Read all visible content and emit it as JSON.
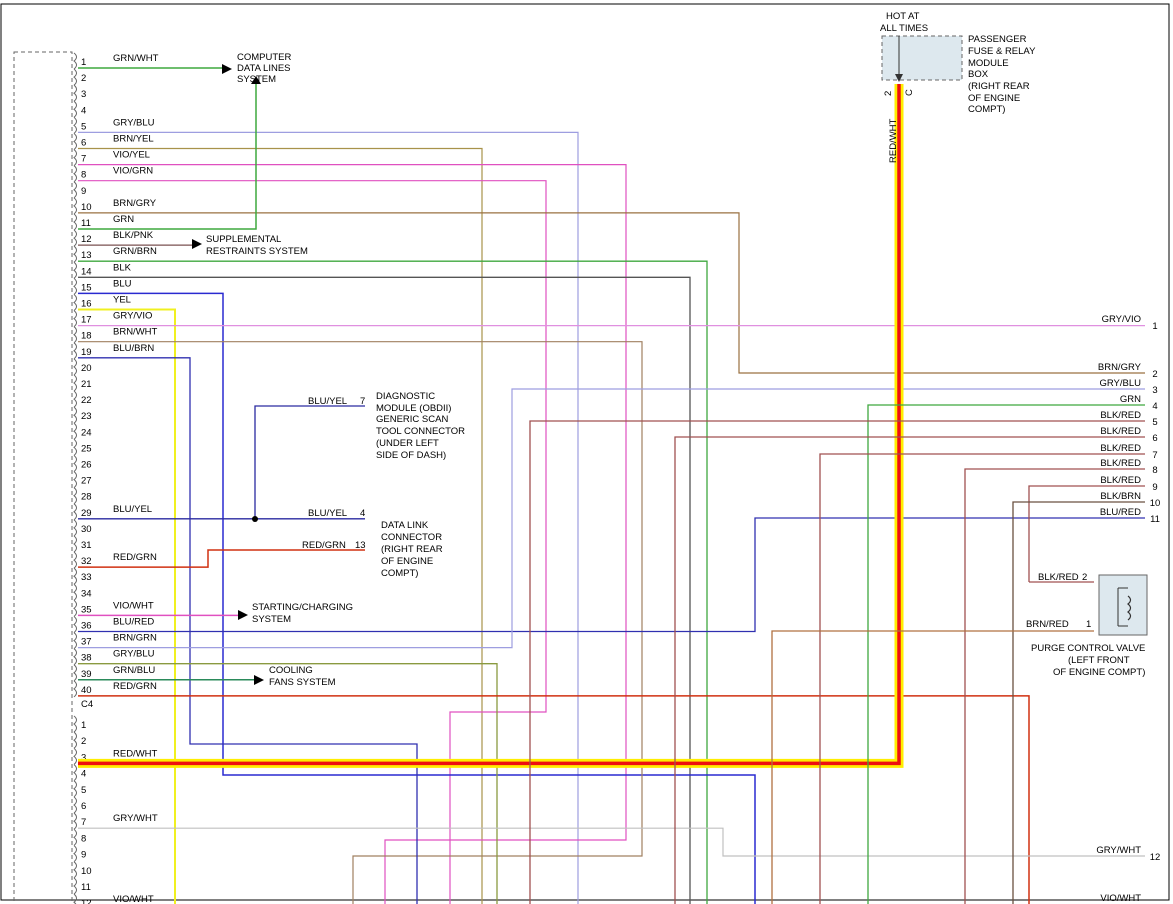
{
  "connector_c3_pins": [
    {
      "pin": "1",
      "label": "GRN/WHT"
    },
    {
      "pin": "2",
      "label": ""
    },
    {
      "pin": "3",
      "label": ""
    },
    {
      "pin": "4",
      "label": ""
    },
    {
      "pin": "5",
      "label": "GRY/BLU"
    },
    {
      "pin": "6",
      "label": "BRN/YEL"
    },
    {
      "pin": "7",
      "label": "VIO/YEL"
    },
    {
      "pin": "8",
      "label": "VIO/GRN"
    },
    {
      "pin": "9",
      "label": ""
    },
    {
      "pin": "10",
      "label": "BRN/GRY"
    },
    {
      "pin": "11",
      "label": "GRN"
    },
    {
      "pin": "12",
      "label": "BLK/PNK"
    },
    {
      "pin": "13",
      "label": "GRN/BRN"
    },
    {
      "pin": "14",
      "label": "BLK"
    },
    {
      "pin": "15",
      "label": "BLU"
    },
    {
      "pin": "16",
      "label": "YEL"
    },
    {
      "pin": "17",
      "label": "GRY/VIO"
    },
    {
      "pin": "18",
      "label": "BRN/WHT"
    },
    {
      "pin": "19",
      "label": "BLU/BRN"
    },
    {
      "pin": "20",
      "label": ""
    },
    {
      "pin": "21",
      "label": ""
    },
    {
      "pin": "22",
      "label": ""
    },
    {
      "pin": "23",
      "label": ""
    },
    {
      "pin": "24",
      "label": ""
    },
    {
      "pin": "25",
      "label": ""
    },
    {
      "pin": "26",
      "label": ""
    },
    {
      "pin": "27",
      "label": ""
    },
    {
      "pin": "28",
      "label": ""
    },
    {
      "pin": "29",
      "label": "BLU/YEL"
    },
    {
      "pin": "30",
      "label": ""
    },
    {
      "pin": "31",
      "label": ""
    },
    {
      "pin": "32",
      "label": "RED/GRN"
    },
    {
      "pin": "33",
      "label": ""
    },
    {
      "pin": "34",
      "label": ""
    },
    {
      "pin": "35",
      "label": "VIO/WHT"
    },
    {
      "pin": "36",
      "label": "BLU/RED"
    },
    {
      "pin": "37",
      "label": "BRN/GRN"
    },
    {
      "pin": "38",
      "label": "GRY/BLU"
    },
    {
      "pin": "39",
      "label": "GRN/BLU"
    },
    {
      "pin": "40",
      "label": "RED/GRN"
    }
  ],
  "connector_c4_label": "C4",
  "connector_c4_pins": [
    {
      "pin": "1",
      "label": ""
    },
    {
      "pin": "2",
      "label": ""
    },
    {
      "pin": "3",
      "label": "RED/WHT"
    },
    {
      "pin": "4",
      "label": ""
    },
    {
      "pin": "5",
      "label": ""
    },
    {
      "pin": "6",
      "label": ""
    },
    {
      "pin": "7",
      "label": "GRY/WHT"
    },
    {
      "pin": "8",
      "label": ""
    },
    {
      "pin": "9",
      "label": ""
    },
    {
      "pin": "10",
      "label": ""
    },
    {
      "pin": "11",
      "label": ""
    },
    {
      "pin": "12",
      "label": "VIO/WHT"
    }
  ],
  "destinations": {
    "computer_data_lines": [
      "COMPUTER",
      "DATA LINES",
      "SYSTEM"
    ],
    "supplemental_restraints": [
      "SUPPLEMENTAL",
      "RESTRAINTS SYSTEM"
    ],
    "starting_charging": [
      "STARTING/CHARGING",
      "SYSTEM"
    ],
    "cooling_fans": [
      "COOLING",
      "FANS SYSTEM"
    ],
    "diagnostic_module": [
      "DIAGNOSTIC",
      "MODULE (OBDII)",
      "GENERIC SCAN",
      "TOOL CONNECTOR",
      "(UNDER LEFT",
      "SIDE OF DASH)"
    ],
    "data_link_connector": [
      "DATA LINK",
      "CONNECTOR",
      "(RIGHT REAR",
      "OF ENGINE",
      "COMPT)"
    ],
    "fuse_box": [
      "PASSENGER",
      "FUSE & RELAY",
      "MODULE",
      "BOX",
      "(RIGHT REAR",
      "OF ENGINE",
      "COMPT)"
    ],
    "hot_at_all_times": [
      "HOT AT",
      "ALL TIMES"
    ],
    "purge_valve": [
      "PURGE CONTROL VALVE",
      "(LEFT FRONT",
      "OF ENGINE COMPT)"
    ]
  },
  "diag_wires": [
    {
      "label": "BLU/YEL",
      "pin": "7"
    },
    {
      "label": "BLU/YEL",
      "pin": "4"
    },
    {
      "label": "RED/GRN",
      "pin": "13"
    }
  ],
  "fuse_pins": {
    "left": "2",
    "right": "C",
    "wire_label": "RED/WHT"
  },
  "right_wires": [
    {
      "label": "GRY/VIO",
      "pin": "1"
    },
    {
      "label": "BRN/GRY",
      "pin": "2"
    },
    {
      "label": "GRY/BLU",
      "pin": "3"
    },
    {
      "label": "GRN",
      "pin": "4"
    },
    {
      "label": "BLK/RED",
      "pin": "5"
    },
    {
      "label": "BLK/RED",
      "pin": "6"
    },
    {
      "label": "BLK/RED",
      "pin": "7"
    },
    {
      "label": "BLK/RED",
      "pin": "8"
    },
    {
      "label": "BLK/RED",
      "pin": "9"
    },
    {
      "label": "BLK/BRN",
      "pin": "10"
    },
    {
      "label": "BLU/RED",
      "pin": "11"
    },
    {
      "label": "GRY/WHT",
      "pin": "12"
    },
    {
      "label": "VIO/WHT",
      "pin": ""
    }
  ],
  "purge_pins": [
    {
      "label": "BLK/RED",
      "pin": "2"
    },
    {
      "label": "BRN/RED",
      "pin": "1"
    }
  ],
  "colors": {
    "grn_wht": "#3fa83f",
    "gry_blu": "#9e9ee0",
    "brn_yel": "#a8924a",
    "vio_yel": "#e050c0",
    "vio_grn": "#e050c0",
    "brn_gry": "#9a7040",
    "grn": "#3fa83f",
    "blk_pnk": "#7a5050",
    "grn_brn": "#3fa83f",
    "blk": "#555555",
    "blu": "#2a2ad0",
    "yel": "#f0f020",
    "gry_vio": "#e090e0",
    "brn_wht": "#a08060",
    "blu_brn": "#3030b0",
    "blu_yel": "#2a2aa0",
    "red_grn": "#d03010",
    "red_wht": "#ee1010",
    "hot_yellow": "#ffee00",
    "blk_red": "#a05050"
  }
}
